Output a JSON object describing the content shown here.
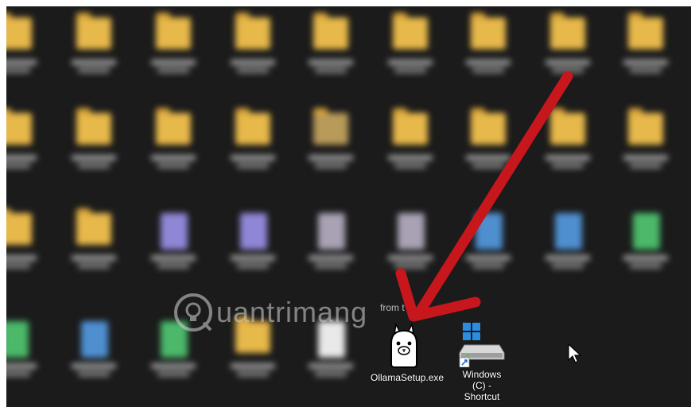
{
  "desktop": {
    "blurred_icons": [
      {
        "kind": "folder",
        "col": 0,
        "row": 0
      },
      {
        "kind": "folder",
        "col": 1,
        "row": 0
      },
      {
        "kind": "folder",
        "col": 2,
        "row": 0
      },
      {
        "kind": "folder",
        "col": 3,
        "row": 0
      },
      {
        "kind": "folder",
        "col": 4,
        "row": 0
      },
      {
        "kind": "folder",
        "col": 5,
        "row": 0
      },
      {
        "kind": "folder",
        "col": 6,
        "row": 0
      },
      {
        "kind": "folder",
        "col": 7,
        "row": 0
      },
      {
        "kind": "folder",
        "col": 8,
        "row": 0
      },
      {
        "kind": "folder",
        "col": 0,
        "row": 1
      },
      {
        "kind": "folder",
        "col": 1,
        "row": 1
      },
      {
        "kind": "folder",
        "col": 2,
        "row": 1
      },
      {
        "kind": "folder",
        "col": 3,
        "row": 1
      },
      {
        "kind": "folder-photo",
        "col": 4,
        "row": 1
      },
      {
        "kind": "folder",
        "col": 5,
        "row": 1
      },
      {
        "kind": "folder",
        "col": 6,
        "row": 1
      },
      {
        "kind": "folder",
        "col": 7,
        "row": 1
      },
      {
        "kind": "folder",
        "col": 8,
        "row": 1
      },
      {
        "kind": "folder",
        "col": 0,
        "row": 2
      },
      {
        "kind": "folder",
        "col": 1,
        "row": 2
      },
      {
        "kind": "image-purple",
        "col": 2,
        "row": 2
      },
      {
        "kind": "image-purple",
        "col": 3,
        "row": 2
      },
      {
        "kind": "image-gray",
        "col": 4,
        "row": 2
      },
      {
        "kind": "image-gray",
        "col": 5,
        "row": 2
      },
      {
        "kind": "image-blue",
        "col": 6,
        "row": 2
      },
      {
        "kind": "image-blue",
        "col": 7,
        "row": 2
      },
      {
        "kind": "image-green",
        "col": 8,
        "row": 2
      },
      {
        "kind": "image-green",
        "col": 0,
        "row": 3
      },
      {
        "kind": "image-blue",
        "col": 1,
        "row": 3
      },
      {
        "kind": "image-green",
        "col": 2,
        "row": 3
      },
      {
        "kind": "folder",
        "col": 3,
        "row": 3
      },
      {
        "kind": "file-white",
        "col": 4,
        "row": 3
      }
    ],
    "ollama_icon": {
      "label": "OllamaSetup.exe"
    },
    "shortcut_icon": {
      "label": "Windows (C) - Shortcut"
    },
    "faded_label_fragment": "from t",
    "watermark": {
      "text": "uantrimang"
    },
    "colors": {
      "background": "#1b1b1b",
      "folder": "#e7b84a",
      "arrow": "#c8161d",
      "label": "#ffffff"
    },
    "cursor_icon": "mouse-pointer-icon"
  }
}
